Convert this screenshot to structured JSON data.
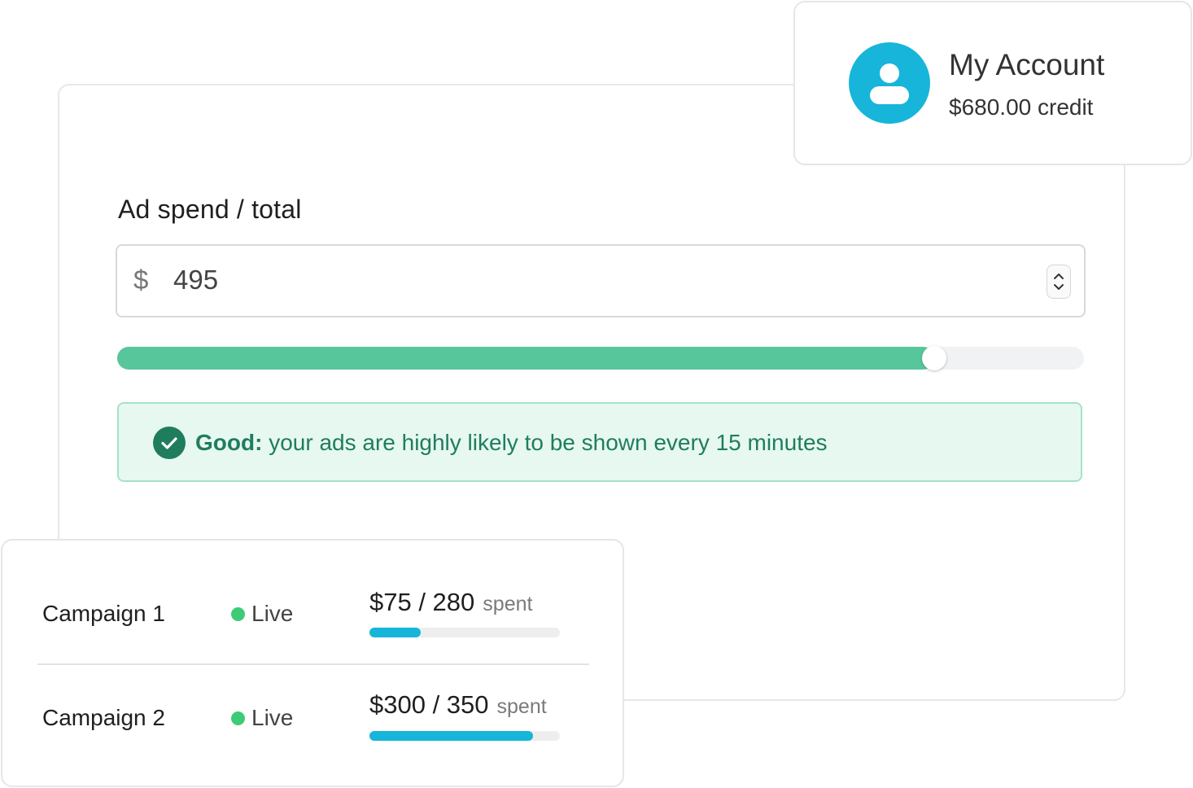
{
  "ad_spend": {
    "label": "Ad spend / total",
    "currency_symbol": "$",
    "value": "495",
    "slider_fraction": 0.845
  },
  "alert": {
    "strong": "Good:",
    "message": " your ads are highly likely to be shown every 15 minutes",
    "icon": "check-circle-icon"
  },
  "account": {
    "title": "My Account",
    "credit": "$680.00 credit",
    "icon": "user-icon"
  },
  "campaigns": [
    {
      "name": "Campaign 1",
      "status": "Live",
      "spent": "$75 / 280",
      "spent_label": "spent",
      "spent_fraction": 0.268
    },
    {
      "name": "Campaign 2",
      "status": "Live",
      "spent": "$300 / 350",
      "spent_label": "spent",
      "spent_fraction": 0.857
    }
  ],
  "colors": {
    "accent_green": "#57c79b",
    "accent_blue": "#17b5da",
    "alert_text": "#1f7d5e",
    "live_dot": "#3ecb76"
  }
}
